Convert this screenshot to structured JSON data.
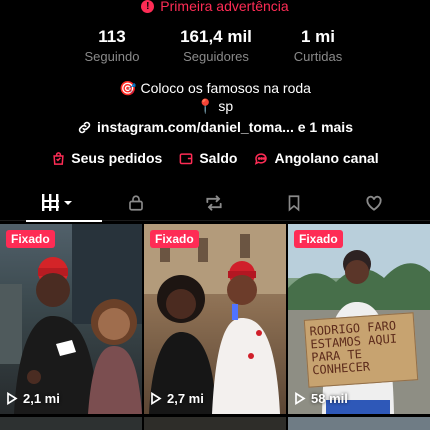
{
  "warning": {
    "text": "Primeira advertência",
    "icon": "alert-icon"
  },
  "stats": [
    {
      "value": "113",
      "label": "Seguindo"
    },
    {
      "value": "161,4 mil",
      "label": "Seguidores"
    },
    {
      "value": "1 mi",
      "label": "Curtidas"
    }
  ],
  "bio": {
    "line1": "Coloco os famosos na roda",
    "line2": "sp",
    "emoji1": "🎯",
    "emoji2": "📍"
  },
  "link": {
    "text": "instagram.com/daniel_toma... e 1 mais"
  },
  "actions": [
    {
      "label": "Seus pedidos",
      "icon": "cart-icon"
    },
    {
      "label": "Saldo",
      "icon": "wallet-icon"
    },
    {
      "label": "Angolano canal",
      "icon": "chat-icon"
    }
  ],
  "tabs": [
    "videos-grid-icon",
    "lock-icon",
    "repost-icon",
    "bookmark-icon",
    "heart-icon"
  ],
  "videos": [
    {
      "badge": "Fixado",
      "views": "2,1 mi"
    },
    {
      "badge": "Fixado",
      "views": "2,7 mi"
    },
    {
      "badge": "Fixado",
      "views": "58 mil"
    }
  ],
  "sign": {
    "text": "RODRIGO FARO ESTAMOS AQUI PARA TE CONHECER"
  },
  "colors": {
    "accent": "#fe2c55",
    "muted": "#8a8a8a",
    "background": "#000000"
  }
}
